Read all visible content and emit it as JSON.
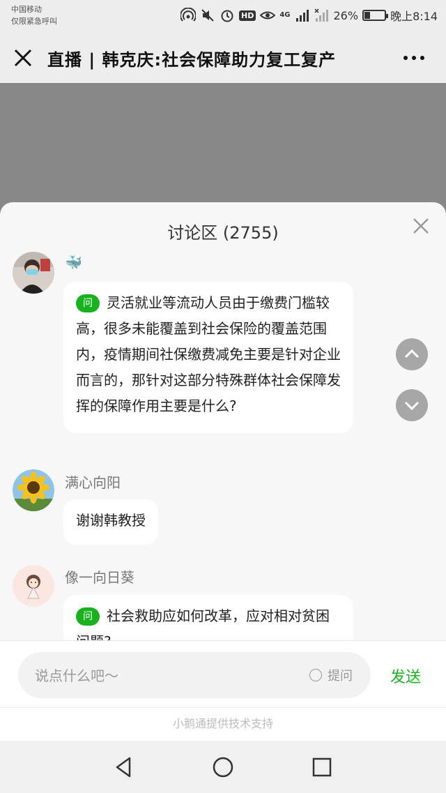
{
  "status": {
    "carrier_line1": "中国移动",
    "carrier_line2": "仅限紧急呼叫",
    "network": "4G",
    "battery": "26%",
    "battery_level": 0.26,
    "time": "晚上8:14"
  },
  "header": {
    "title": "直播 | 韩克庆:社会保障助力复工复产"
  },
  "discussion": {
    "title": "讨论区 (2755)",
    "messages": [
      {
        "username": "🐳",
        "badge": "问",
        "text": "灵活就业等流动人员由于缴费门槛较高，很多未能覆盖到社会保险的覆盖范围内，疫情期间社保缴费减免主要是针对企业而言的，那针对这部分特殊群体社会保障发挥的保障作用主要是什么?"
      },
      {
        "username": "满心向阳",
        "text": "谢谢韩教授"
      },
      {
        "username": "像一向日葵",
        "badge": "问",
        "text": "社会救助应如何改革，应对相对贫困问题?"
      }
    ]
  },
  "composer": {
    "placeholder": "说点什么吧～",
    "ask_label": "提问",
    "send_label": "发送"
  },
  "footer": {
    "text": "小鹅通提供技术支持"
  },
  "colors": {
    "accent": "#19b21f",
    "video_bg": "#888888",
    "panel_bg": "#f7f7f7"
  }
}
